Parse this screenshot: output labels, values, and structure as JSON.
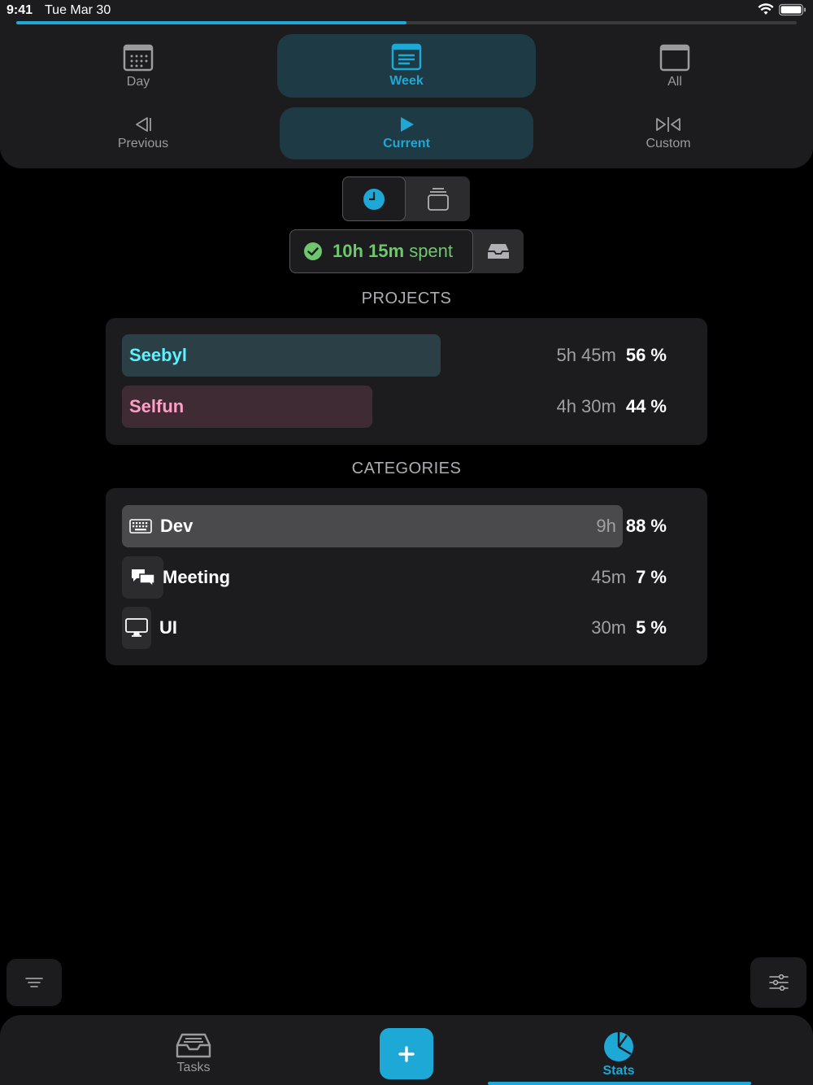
{
  "status_bar": {
    "time": "9:41",
    "date": "Tue Mar 30",
    "progress_fraction": 0.5
  },
  "range_selector": {
    "periods": [
      {
        "label": "Day",
        "icon": "calendar-grid-icon",
        "active": false
      },
      {
        "label": "Week",
        "icon": "calendar-week-icon",
        "active": true
      },
      {
        "label": "All",
        "icon": "calendar-all-icon",
        "active": false
      }
    ],
    "navigation": [
      {
        "label": "Previous",
        "icon": "previous-icon",
        "active": false
      },
      {
        "label": "Current",
        "icon": "play-icon",
        "active": true
      },
      {
        "label": "Custom",
        "icon": "custom-range-icon",
        "active": false
      }
    ]
  },
  "view_toggle": {
    "options": [
      {
        "icon": "clock-icon",
        "active": true
      },
      {
        "icon": "stack-icon",
        "active": false
      }
    ]
  },
  "summary": {
    "spent_value": "10h 15m",
    "spent_suffix": "spent",
    "icon": "check-circle-icon",
    "inbox_icon": "inbox-icon"
  },
  "projects": {
    "title": "PROJECTS",
    "items": [
      {
        "name": "Seebyl",
        "time": "5h 45m",
        "percent": "56 %",
        "share": 0.56,
        "color": "#5ef2ff",
        "bar_color": "#2b3f47"
      },
      {
        "name": "Selfun",
        "time": "4h 30m",
        "percent": "44 %",
        "share": 0.44,
        "color": "#ff9ec7",
        "bar_color": "#3e2b33"
      }
    ]
  },
  "categories": {
    "title": "CATEGORIES",
    "items": [
      {
        "name": "Dev",
        "time": "9h",
        "percent": "88 %",
        "share": 0.88,
        "icon": "keyboard-icon"
      },
      {
        "name": "Meeting",
        "time": "45m",
        "percent": "7 %",
        "share": 0.07,
        "icon": "chat-bubbles-icon"
      },
      {
        "name": "UI",
        "time": "30m",
        "percent": "5 %",
        "share": 0.05,
        "icon": "monitor-icon"
      }
    ]
  },
  "floating": {
    "left_icon": "filter-lines-icon",
    "right_icon": "sliders-icon"
  },
  "tabbar": {
    "tabs": [
      {
        "label": "Tasks",
        "icon": "inbox-tray-icon",
        "active": false
      },
      {
        "label": "Stats",
        "icon": "pie-chart-icon",
        "active": true
      }
    ],
    "add_icon": "plus-icon"
  },
  "colors": {
    "accent": "#1da8d6",
    "success": "#6ec76e",
    "panel": "#1c1c1e",
    "background": "#000000"
  }
}
